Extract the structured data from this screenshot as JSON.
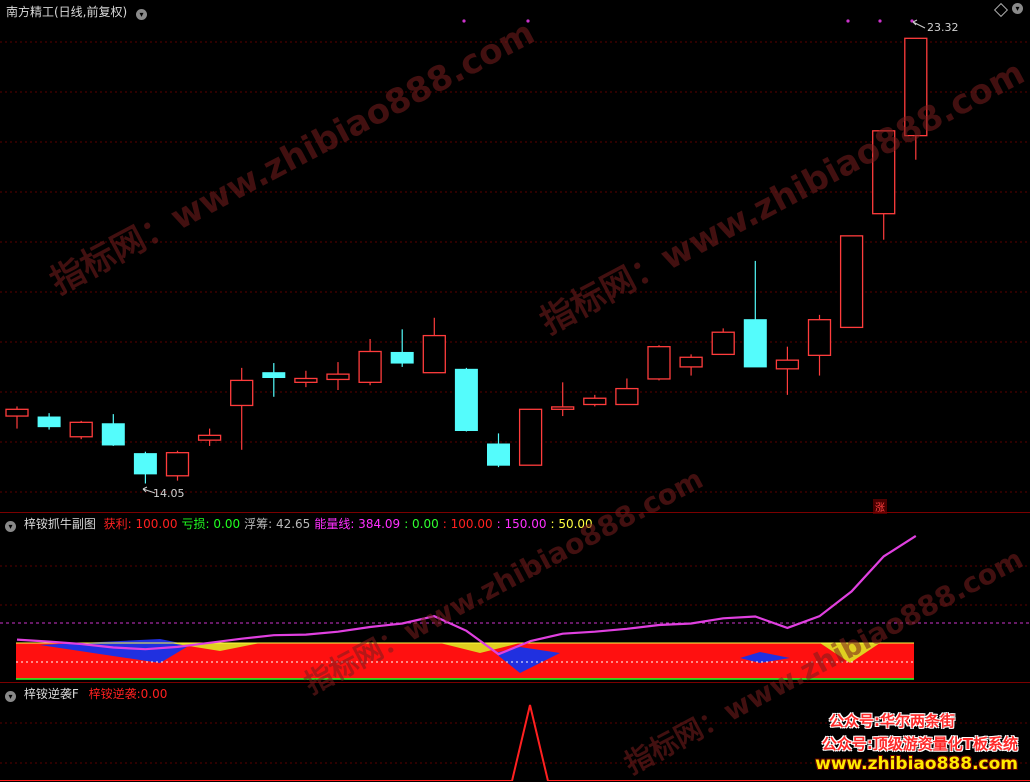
{
  "main": {
    "title": "南方精工(日线,前复权)",
    "high_label": "23.32",
    "low_label": "14.05",
    "rise_marker": "涨",
    "candles": [
      {
        "o": 15.62,
        "c": 15.48,
        "h": 15.68,
        "l": 15.22,
        "up": true
      },
      {
        "o": 15.46,
        "c": 15.26,
        "h": 15.54,
        "l": 15.2,
        "up": false
      },
      {
        "o": 15.35,
        "c": 15.05,
        "h": 15.38,
        "l": 15.0,
        "up": true
      },
      {
        "o": 15.32,
        "c": 14.88,
        "h": 15.52,
        "l": 14.86,
        "up": false
      },
      {
        "o": 14.7,
        "c": 14.28,
        "h": 14.74,
        "l": 14.08,
        "up": false
      },
      {
        "o": 14.24,
        "c": 14.72,
        "h": 14.76,
        "l": 14.14,
        "up": true
      },
      {
        "o": 14.98,
        "c": 15.08,
        "h": 15.22,
        "l": 14.86,
        "up": true
      },
      {
        "o": 15.7,
        "c": 16.22,
        "h": 16.48,
        "l": 14.78,
        "up": true
      },
      {
        "o": 16.28,
        "c": 16.38,
        "h": 16.58,
        "l": 15.88,
        "up": false
      },
      {
        "o": 16.18,
        "c": 16.26,
        "h": 16.42,
        "l": 16.08,
        "up": true
      },
      {
        "o": 16.24,
        "c": 16.35,
        "h": 16.6,
        "l": 16.02,
        "up": true
      },
      {
        "o": 16.18,
        "c": 16.82,
        "h": 17.08,
        "l": 16.12,
        "up": true
      },
      {
        "o": 16.8,
        "c": 16.58,
        "h": 17.28,
        "l": 16.5,
        "up": false
      },
      {
        "o": 16.38,
        "c": 17.15,
        "h": 17.52,
        "l": 16.38,
        "up": true
      },
      {
        "o": 16.45,
        "c": 15.18,
        "h": 16.48,
        "l": 15.16,
        "up": false
      },
      {
        "o": 14.9,
        "c": 14.46,
        "h": 15.12,
        "l": 14.42,
        "up": false
      },
      {
        "o": 14.46,
        "c": 15.62,
        "h": 15.62,
        "l": 14.46,
        "up": true
      },
      {
        "o": 15.62,
        "c": 15.67,
        "h": 16.18,
        "l": 15.48,
        "up": true
      },
      {
        "o": 15.72,
        "c": 15.85,
        "h": 15.92,
        "l": 15.68,
        "up": true
      },
      {
        "o": 15.72,
        "c": 16.05,
        "h": 16.26,
        "l": 15.72,
        "up": true
      },
      {
        "o": 16.25,
        "c": 16.92,
        "h": 16.95,
        "l": 16.22,
        "up": true
      },
      {
        "o": 16.5,
        "c": 16.7,
        "h": 16.76,
        "l": 16.32,
        "up": true
      },
      {
        "o": 16.76,
        "c": 17.22,
        "h": 17.3,
        "l": 16.76,
        "up": true
      },
      {
        "o": 17.48,
        "c": 16.5,
        "h": 18.7,
        "l": 16.5,
        "up": false
      },
      {
        "o": 16.46,
        "c": 16.64,
        "h": 16.92,
        "l": 15.92,
        "up": true
      },
      {
        "o": 16.74,
        "c": 17.48,
        "h": 17.58,
        "l": 16.32,
        "up": true
      },
      {
        "o": 17.32,
        "c": 19.22,
        "h": 19.22,
        "l": 17.32,
        "up": true
      },
      {
        "o": 19.68,
        "c": 21.4,
        "h": 21.4,
        "l": 19.14,
        "up": true
      },
      {
        "o": 21.3,
        "c": 23.32,
        "h": 23.32,
        "l": 20.8,
        "up": true
      }
    ],
    "ylim": [
      13.8,
      23.7
    ]
  },
  "sub1": {
    "title": "梓铵抓牛副图",
    "items": [
      {
        "label": "获利",
        "value": "100.00",
        "color": "#ff2020"
      },
      {
        "label": "亏损",
        "value": "0.00",
        "color": "#20ff20"
      },
      {
        "label": "浮筹",
        "value": "42.65",
        "color": "#b8b8b8"
      },
      {
        "label": "能量线",
        "value": "384.09",
        "color": "#ff30ff"
      },
      {
        "label": "",
        "value": "0.00",
        "color": "#30ff30"
      },
      {
        "label": "",
        "value": "100.00",
        "color": "#ff2020"
      },
      {
        "label": "",
        "value": "150.00",
        "color": "#ff30ff"
      },
      {
        "label": "",
        "value": "50.00",
        "color": "#ffff40"
      }
    ],
    "energy_line": [
      135,
      128,
      120,
      108,
      102,
      110,
      124,
      138,
      150,
      152,
      162,
      178,
      190,
      215,
      165,
      85,
      130,
      155,
      162,
      172,
      185,
      190,
      208,
      214,
      175,
      215,
      300,
      420,
      490
    ]
  },
  "sub2": {
    "title": "梓铵逆袭F",
    "label": "梓铵逆袭",
    "value": "0.00"
  },
  "watermark": {
    "text": "指标网：www.zhibiao888.com"
  },
  "promo": {
    "line1": "公众号:华尔两条街",
    "line2": "公众号:顶级游资量化T板系统",
    "line3": "www.zhibiao888.com"
  },
  "colors": {
    "up": "#ff3c3c",
    "down": "#54fcfc",
    "grid": "#5a0000",
    "magenta": "#cc33cc"
  }
}
